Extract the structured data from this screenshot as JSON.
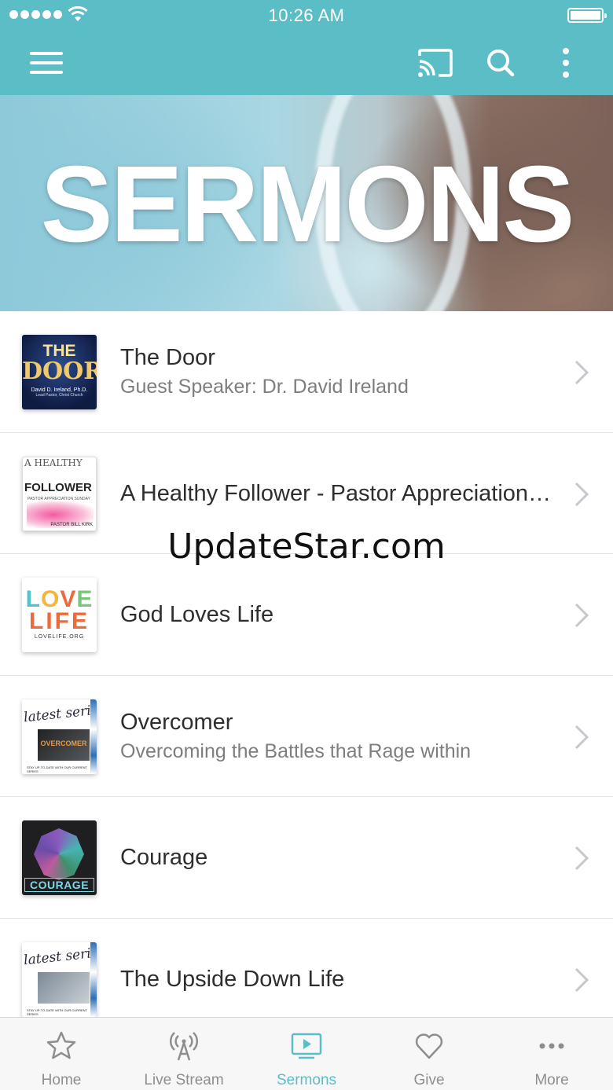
{
  "status_bar": {
    "time": "10:26 AM"
  },
  "colors": {
    "accent": "#5bbec7",
    "tab_inactive": "#8e8e8e"
  },
  "toolbar": {
    "icons": [
      "menu-icon",
      "cast-icon",
      "search-icon",
      "more-vertical-icon"
    ]
  },
  "hero": {
    "title": "SERMONS"
  },
  "sermons": [
    {
      "title": "The Door",
      "subtitle": "Guest Speaker: Dr. David Ireland",
      "thumb": {
        "line1": "THE",
        "line2": "DOOR",
        "line3": "David D. Ireland, Ph.D.",
        "line4": "Lead Pastor, Christ Church"
      }
    },
    {
      "title": "A Healthy Follower - Pastor Appreciation Sunday",
      "subtitle": "",
      "thumb": {
        "line1": "A HEALTHY",
        "line2": "FOLLOWER",
        "line3": "PASTOR APPRECIATION SUNDAY 2019",
        "line4": "PASTOR BILL KIRK"
      }
    },
    {
      "title": "God Loves Life",
      "subtitle": "",
      "thumb": {
        "line1": "LOVE",
        "line2": "LIFE",
        "line3": "LOVELIFE.ORG"
      }
    },
    {
      "title": "Overcomer",
      "subtitle": "Overcoming the Battles that Rage within",
      "thumb": {
        "line1": "latest series",
        "line2": "OVERCOMER",
        "line3": "STAY UP-TO-DATE WITH OUR CURRENT SERIES"
      }
    },
    {
      "title": "Courage",
      "subtitle": "",
      "thumb": {
        "line1": "COURAGE"
      }
    },
    {
      "title": "The Upside Down Life",
      "subtitle": "",
      "thumb": {
        "line1": "latest series",
        "line2": "",
        "line3": "STAY UP-TO-DATE WITH OUR CURRENT SERIES"
      }
    }
  ],
  "watermark": "UpdateStar.com",
  "tabs": [
    {
      "label": "Home",
      "icon": "star-icon",
      "active": false
    },
    {
      "label": "Live Stream",
      "icon": "broadcast-icon",
      "active": false
    },
    {
      "label": "Sermons",
      "icon": "tv-play-icon",
      "active": true
    },
    {
      "label": "Give",
      "icon": "heart-icon",
      "active": false
    },
    {
      "label": "More",
      "icon": "more-horizontal-icon",
      "active": false
    }
  ]
}
